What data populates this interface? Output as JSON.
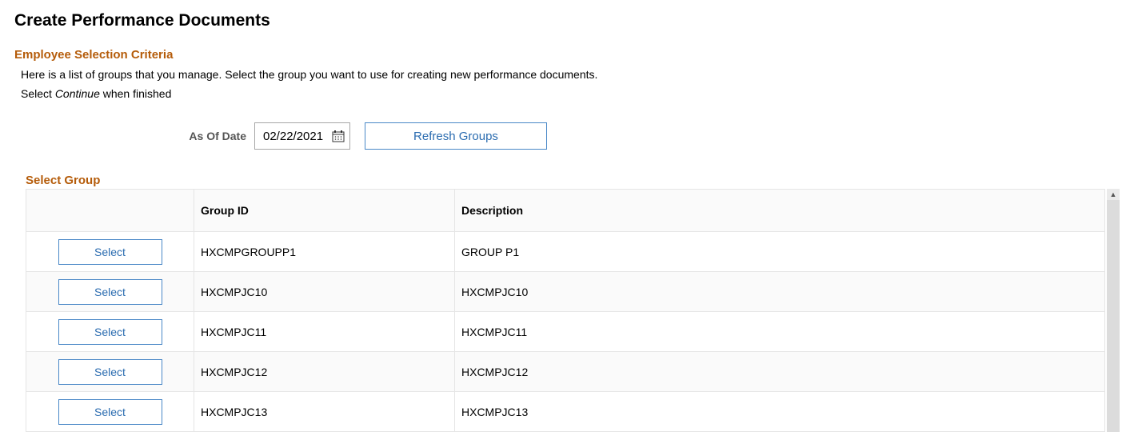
{
  "page": {
    "title": "Create Performance Documents",
    "section_title": "Employee Selection Criteria",
    "instruction1": "Here is a list of groups that you manage. Select the group you want to use for creating new performance documents.",
    "instruction2_pre": "Select ",
    "instruction2_italic": "Continue",
    "instruction2_post": " when finished"
  },
  "date": {
    "label": "As Of Date",
    "value": "02/22/2021"
  },
  "buttons": {
    "refresh": "Refresh Groups",
    "select": "Select"
  },
  "grid": {
    "title": "Select Group",
    "headers": {
      "select": "",
      "group_id": "Group ID",
      "description": "Description"
    },
    "rows": [
      {
        "group_id": "HXCMPGROUPP1",
        "description": "GROUP P1"
      },
      {
        "group_id": "HXCMPJC10",
        "description": "HXCMPJC10"
      },
      {
        "group_id": "HXCMPJC11",
        "description": "HXCMPJC11"
      },
      {
        "group_id": "HXCMPJC12",
        "description": "HXCMPJC12"
      },
      {
        "group_id": "HXCMPJC13",
        "description": "HXCMPJC13"
      }
    ]
  }
}
